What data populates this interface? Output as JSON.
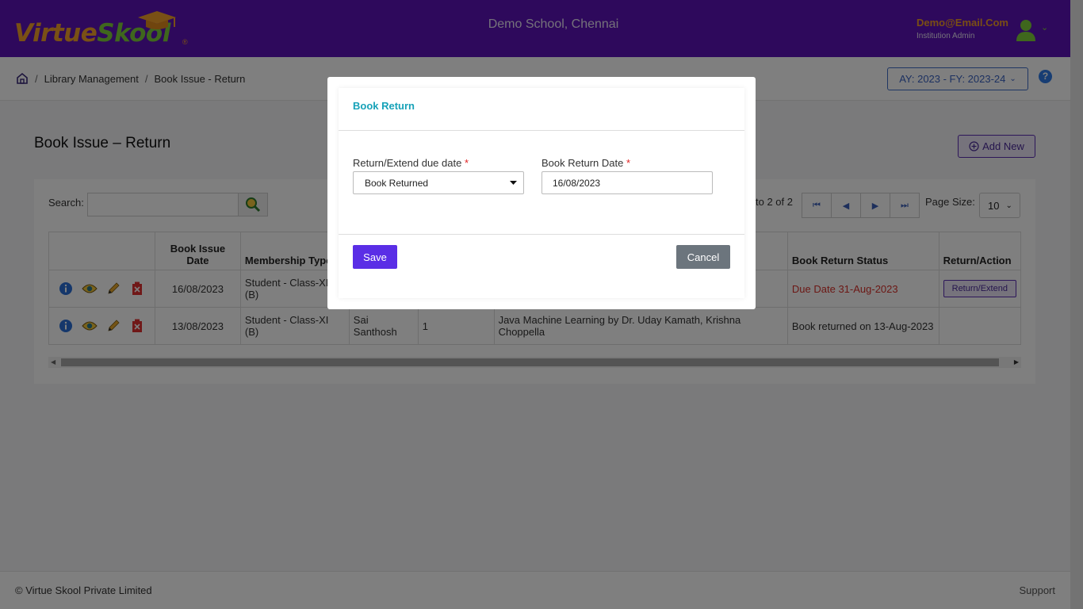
{
  "header": {
    "logo_virtue": "Virtue",
    "logo_skool": "Skool",
    "logo_reg": "®",
    "school_name": "Demo School, Chennai",
    "user_email": "Demo@Email.Com",
    "user_role": "Institution Admin"
  },
  "breadcrumb": {
    "items": [
      "Library Management",
      "Book Issue - Return"
    ],
    "separator": "/"
  },
  "academic_year": "AY: 2023 - FY: 2023-24",
  "help_label": "?",
  "page": {
    "title": "Book Issue – Return",
    "add_new_label": "Add New"
  },
  "search": {
    "label": "Search:",
    "value": ""
  },
  "pagination": {
    "info": "to 2 of 2",
    "page_size_label": "Page Size:",
    "page_size": "10"
  },
  "table": {
    "columns": [
      "",
      "Book Issue Date",
      "Membership Type",
      "",
      "",
      "",
      "Book Return Status",
      "Return/Action"
    ],
    "rows": [
      {
        "issue_date": "16/08/2023",
        "membership": "Student - Class-XI (B)",
        "member": "",
        "quantity": "",
        "books": "",
        "status": "Due Date 31-Aug-2023",
        "action": "Return/Extend"
      },
      {
        "issue_date": "13/08/2023",
        "membership": "Student - Class-XI (B)",
        "member": "Sai Santhosh",
        "quantity": "1",
        "books": "Java Machine Learning by Dr. Uday Kamath, Krishna Choppella",
        "status": "Book returned on 13-Aug-2023",
        "action": ""
      }
    ]
  },
  "footer": {
    "copyright": "© Virtue Skool Private Limited",
    "support": "Support"
  },
  "modal": {
    "title": "Book Return",
    "field1_label": "Return/Extend due date",
    "field1_value": "Book Returned",
    "field2_label": "Book Return Date",
    "field2_value": "16/08/2023",
    "required_mark": "*",
    "save_label": "Save",
    "cancel_label": "Cancel"
  },
  "colors": {
    "header_bg": "#5c12b8",
    "accent_orange": "#f39c28",
    "accent_green": "#7fcf3b",
    "modal_title": "#17a2b8",
    "save_button": "#5a2ee6",
    "due_text": "#d9302a"
  }
}
